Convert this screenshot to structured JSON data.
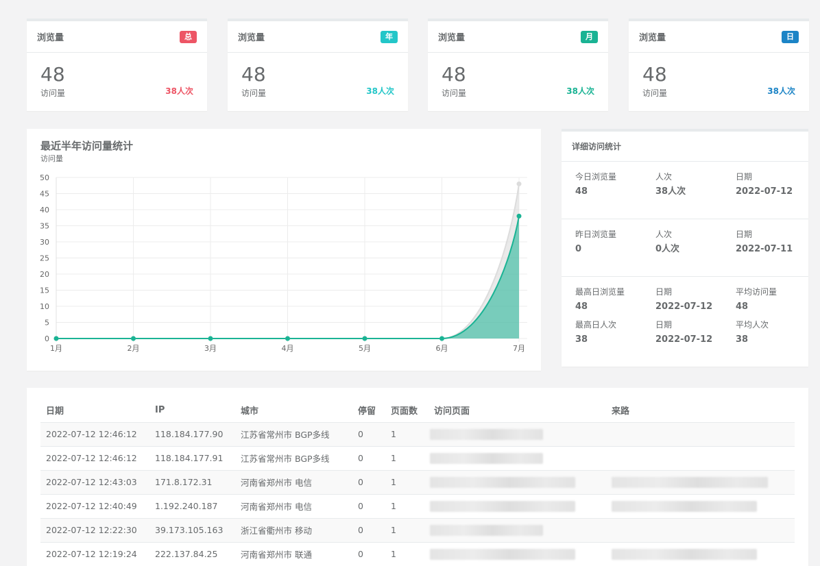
{
  "stat_cards": [
    {
      "title": "浏览量",
      "badge": "总",
      "badge_color": "#ed5565",
      "value": "48",
      "sub": "访问量",
      "right": "38人次",
      "right_color": "#ed5565"
    },
    {
      "title": "浏览量",
      "badge": "年",
      "badge_color": "#23c6c8",
      "value": "48",
      "sub": "访问量",
      "right": "38人次",
      "right_color": "#23c6c8"
    },
    {
      "title": "浏览量",
      "badge": "月",
      "badge_color": "#1ab394",
      "value": "48",
      "sub": "访问量",
      "right": "38人次",
      "right_color": "#1ab394"
    },
    {
      "title": "浏览量",
      "badge": "日",
      "badge_color": "#1c84c6",
      "value": "48",
      "sub": "访问量",
      "right": "38人次",
      "right_color": "#1c84c6"
    }
  ],
  "chart": {
    "title": "最近半年访问量统计",
    "subtitle": "访问量"
  },
  "chart_data": {
    "type": "area",
    "categories": [
      "1月",
      "2月",
      "3月",
      "4月",
      "5月",
      "6月",
      "7月"
    ],
    "series": [
      {
        "values": [
          0,
          0,
          0,
          0,
          0,
          0,
          48
        ],
        "color": "#dcdcdc"
      },
      {
        "values": [
          0,
          0,
          0,
          0,
          0,
          0,
          38
        ],
        "color": "#1ab394"
      }
    ],
    "ylim": [
      0,
      50
    ],
    "yticks": [
      0,
      5,
      10,
      15,
      20,
      25,
      30,
      35,
      40,
      45,
      50
    ],
    "grid": true
  },
  "detail": {
    "title": "详细访问统计",
    "today": {
      "l1": "今日浏览量",
      "v1": "48",
      "l2": "人次",
      "v2": "38人次",
      "l3": "日期",
      "v3": "2022-07-12"
    },
    "yesterday": {
      "l1": "昨日浏览量",
      "v1": "0",
      "l2": "人次",
      "v2": "0人次",
      "l3": "日期",
      "v3": "2022-07-11"
    },
    "max": {
      "l1": "最高日浏览量",
      "v1": "48",
      "l2": "日期",
      "v2": "2022-07-12",
      "l3": "平均访问量",
      "v3": "48",
      "l4": "最高日人次",
      "v4": "38",
      "l5": "日期",
      "v5": "2022-07-12",
      "l6": "平均人次",
      "v6": "38"
    }
  },
  "table": {
    "headers": [
      "日期",
      "IP",
      "城市",
      "停留",
      "页面数",
      "访问页面",
      "来路"
    ],
    "rows": [
      [
        "2022-07-12 12:46:12",
        "118.184.177.90",
        "江苏省常州市 BGP多线",
        "0",
        "1"
      ],
      [
        "2022-07-12 12:46:12",
        "118.184.177.91",
        "江苏省常州市 BGP多线",
        "0",
        "1"
      ],
      [
        "2022-07-12 12:43:03",
        "171.8.172.31",
        "河南省郑州市 电信",
        "0",
        "1"
      ],
      [
        "2022-07-12 12:40:49",
        "1.192.240.187",
        "河南省郑州市 电信",
        "0",
        "1"
      ],
      [
        "2022-07-12 12:22:30",
        "39.173.105.163",
        "浙江省衢州市 移动",
        "0",
        "1"
      ],
      [
        "2022-07-12 12:19:24",
        "222.137.84.25",
        "河南省郑州市 联通",
        "0",
        "1"
      ]
    ]
  }
}
